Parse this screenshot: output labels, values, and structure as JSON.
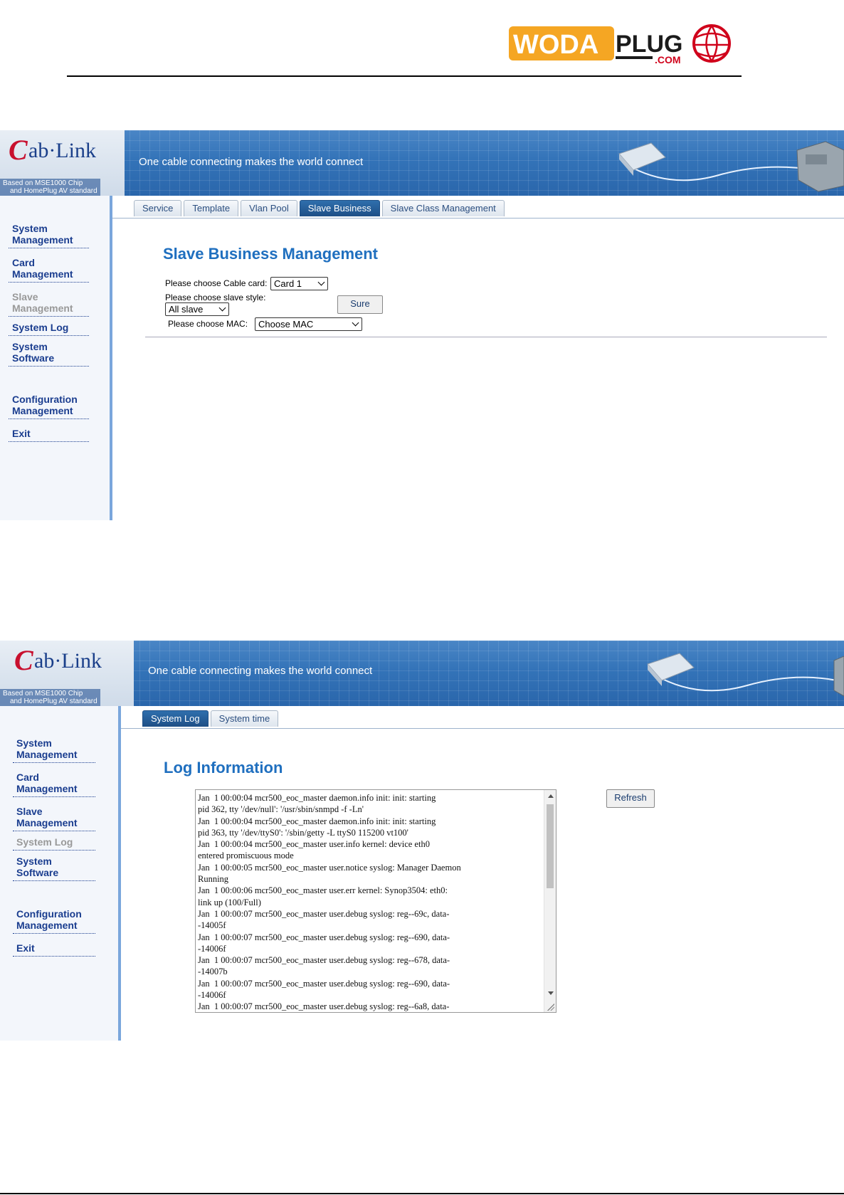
{
  "document": {
    "logo": {
      "wordmark": "WODAPLUG",
      "suffix": ".COM",
      "colors": {
        "orange": "#f5a623",
        "red": "#d0021b",
        "dark": "#1b1b1b"
      }
    }
  },
  "banner": {
    "brand_c": "C",
    "brand_rest": "ab·Link",
    "tagline": "One cable connecting makes the world connect",
    "sub_line1": "Based on MSE1000 Chip",
    "sub_line2": "and HomePlug AV standard"
  },
  "screen1": {
    "sidebar": [
      {
        "label": "System Management",
        "current": false
      },
      {
        "label": "Card Management",
        "current": false
      },
      {
        "label": "Slave Management",
        "current": true
      },
      {
        "label": "System Log",
        "current": false
      },
      {
        "label": "System Software",
        "current": false
      },
      {
        "label": "Configuration Management",
        "current": false
      },
      {
        "label": "Exit",
        "current": false
      }
    ],
    "tabs": [
      "Service",
      "Template",
      "Vlan Pool",
      "Slave Business",
      "Slave Class Management"
    ],
    "active_tab": "Slave Business",
    "title": "Slave Business Management",
    "form": {
      "card_label": "Please choose Cable card:",
      "card_value": "Card 1",
      "style_label": "Please choose slave style:",
      "style_value": "All slave",
      "sure_label": "Sure",
      "mac_label": "Please choose MAC:",
      "mac_value": "Choose MAC"
    }
  },
  "screen2": {
    "sidebar": [
      {
        "label": "System Management",
        "current": false
      },
      {
        "label": "Card Management",
        "current": false
      },
      {
        "label": "Slave Management",
        "current": false
      },
      {
        "label": "System Log",
        "current": true
      },
      {
        "label": "System Software",
        "current": false
      },
      {
        "label": "Configuration Management",
        "current": false
      },
      {
        "label": "Exit",
        "current": false
      }
    ],
    "tabs": [
      "System Log",
      "System time"
    ],
    "active_tab": "System Log",
    "title": "Log Information",
    "refresh_label": "Refresh",
    "log_lines": [
      "Jan  1 00:00:04 mcr500_eoc_master daemon.info init: init: starting",
      "pid 362, tty '/dev/null': '/usr/sbin/snmpd -f -Ln'",
      "Jan  1 00:00:04 mcr500_eoc_master daemon.info init: init: starting",
      "pid 363, tty '/dev/ttyS0': '/sbin/getty -L ttyS0 115200 vt100'",
      "Jan  1 00:00:04 mcr500_eoc_master user.info kernel: device eth0",
      "entered promiscuous mode",
      "Jan  1 00:00:05 mcr500_eoc_master user.notice syslog: Manager Daemon",
      "Running",
      "Jan  1 00:00:06 mcr500_eoc_master user.err kernel: Synop3504: eth0:",
      "link up (100/Full)",
      "Jan  1 00:00:07 mcr500_eoc_master user.debug syslog: reg--69c, data-",
      "-14005f",
      "Jan  1 00:00:07 mcr500_eoc_master user.debug syslog: reg--690, data-",
      "-14006f",
      "Jan  1 00:00:07 mcr500_eoc_master user.debug syslog: reg--678, data-",
      "-14007b",
      "Jan  1 00:00:07 mcr500_eoc_master user.debug syslog: reg--690, data-",
      "-14006f",
      "Jan  1 00:00:07 mcr500_eoc_master user.debug syslog: reg--6a8, data-"
    ]
  }
}
